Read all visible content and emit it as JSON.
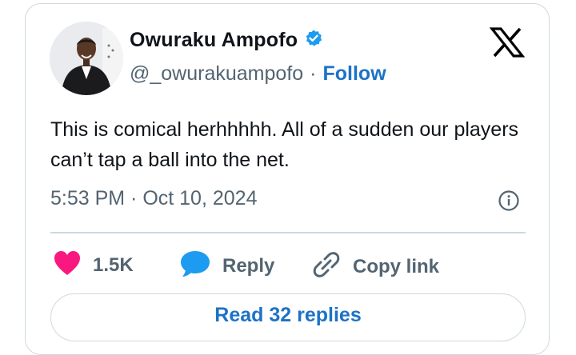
{
  "author": {
    "name": "Owuraku Ampofo",
    "handle": "@_owurakuampofo",
    "separator": "·",
    "follow_label": "Follow"
  },
  "tweet": {
    "text": "This is comical herhhhhh. All of a sudden our players can’t tap a ball into the net.",
    "timestamp": "5:53 PM · Oct 10, 2024"
  },
  "actions": {
    "likes_count": "1.5K",
    "reply_label": "Reply",
    "copy_link_label": "Copy link"
  },
  "read_replies_label": "Read 32 replies",
  "colors": {
    "like": "#f91880",
    "reply": "#1d9bf0",
    "verified": "#1d9bf0",
    "link": "#1d72c6",
    "muted": "#536471"
  },
  "icons": [
    "verified-badge-icon",
    "x-logo-icon",
    "info-icon",
    "heart-icon",
    "reply-bubble-icon",
    "link-icon"
  ]
}
